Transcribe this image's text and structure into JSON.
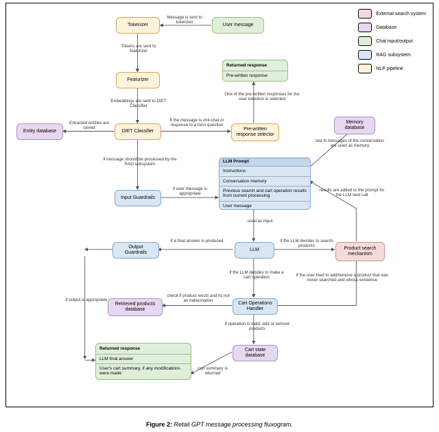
{
  "caption": {
    "label": "Figure 2:",
    "text": "Retail GPT message processing fluxogram."
  },
  "legend": [
    {
      "label": "External search system",
      "class": "pink"
    },
    {
      "label": "Database",
      "class": "purple"
    },
    {
      "label": "Chat input/output",
      "class": "green"
    },
    {
      "label": "RAG subsystem",
      "class": "blue"
    },
    {
      "label": "NLP pipeline",
      "class": "orange"
    }
  ],
  "nodes": {
    "user_message": "User message",
    "tokenizer": "Tokenizer",
    "featurizer": "Featurizer",
    "diet": "DIET Classifier",
    "entity_db": "Entity database",
    "prewritten": "Pre-written response selector",
    "returned_pre": {
      "title": "Returned response",
      "body": "Pre-written response"
    },
    "memory_db": "Memory database",
    "input_guard": "Input Guardrails",
    "llm_prompt": {
      "title": "LLM Prompt",
      "rows": [
        "Instructions",
        "Conversation memory",
        "Previous search and cart operation results from current processing",
        "User message"
      ]
    },
    "llm": "LLM",
    "output_guard": "Output Guardrails",
    "product_search": "Product search mechanism",
    "cart_ops": "Cart Operations Handler",
    "retrieved_db": "Retrieved products database",
    "cart_state_db": "Cart state database",
    "returned_final": {
      "title": "Returned response",
      "rows": [
        "LLM final answer",
        "User's cart summary, if any modifications were made"
      ]
    }
  },
  "edges": {
    "msg_to_tok": "Message is sent to tokenizer",
    "tok_to_feat": "Tokens are sent to featurizer",
    "feat_to_diet": "Embeddings are sent to DIET Classifier",
    "diet_to_entity": "Extracted entities are stored",
    "diet_to_pre": "If the message is chit-chat or response to a form question",
    "pre_to_ret": "One of the pre-written responses for the user intention is selected",
    "diet_to_rag": "if message should be processed by the RAG subsystem",
    "guard_to_prompt": "if user message is appropriate",
    "mem_to_prompt": "last N messages of the conversation are used as memory",
    "prompt_to_llm": "used as input",
    "llm_to_out": "if a final answer is produced",
    "out_to_final": "if output is appropriate",
    "llm_to_search": "if the LLM decides to search products",
    "search_to_prompt": "results are added to the prompt for the LLM next call",
    "llm_to_cart": "if the LLM decides to make a cart operation",
    "cart_to_retr": "check if product exists and its not an hallucination",
    "cart_to_search": "if the user tried to add/remove a product that was never searched and whose existence",
    "cart_to_state": "if operation is valid, add or remove products",
    "state_to_final": "cart summary is returned"
  }
}
